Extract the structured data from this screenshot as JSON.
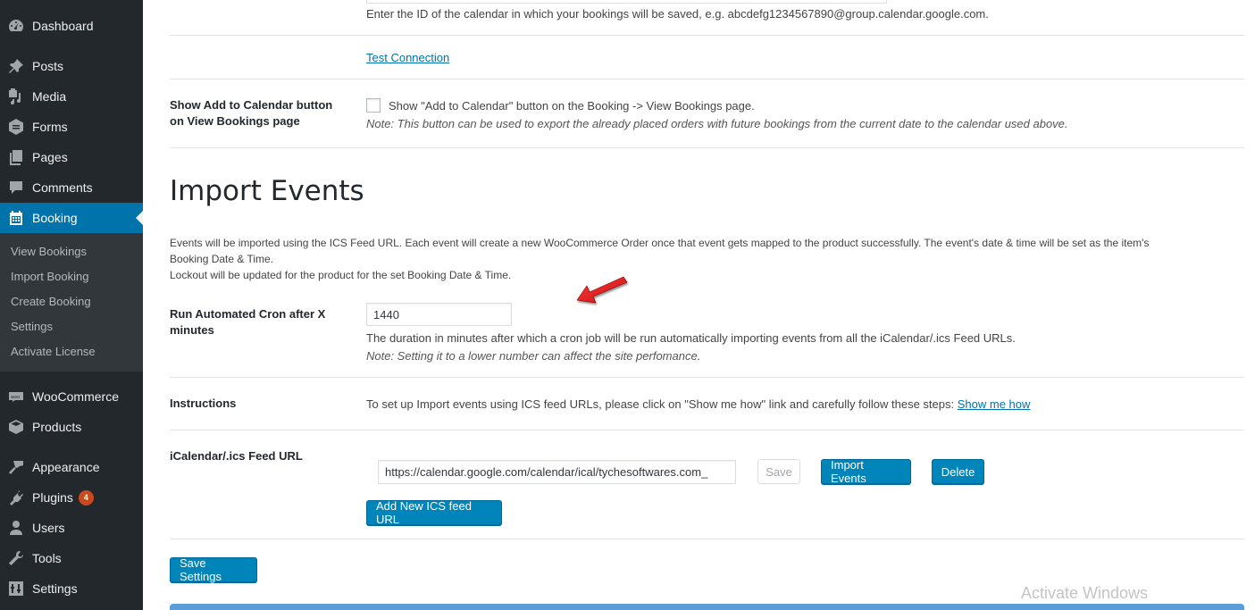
{
  "sidebar": {
    "items": [
      {
        "label": "Dashboard",
        "icon": "dashboard-icon"
      },
      {
        "label": "Posts",
        "icon": "pin-icon"
      },
      {
        "label": "Media",
        "icon": "media-icon"
      },
      {
        "label": "Forms",
        "icon": "forms-icon"
      },
      {
        "label": "Pages",
        "icon": "pages-icon"
      },
      {
        "label": "Comments",
        "icon": "comment-icon"
      },
      {
        "label": "Booking",
        "icon": "calendar-icon",
        "active": true
      },
      {
        "label": "WooCommerce",
        "icon": "woo-icon"
      },
      {
        "label": "Products",
        "icon": "box-icon"
      },
      {
        "label": "Appearance",
        "icon": "brush-icon"
      },
      {
        "label": "Plugins",
        "icon": "plug-icon",
        "badge": "4"
      },
      {
        "label": "Users",
        "icon": "user-icon"
      },
      {
        "label": "Tools",
        "icon": "wrench-icon"
      },
      {
        "label": "Settings",
        "icon": "sliders-icon"
      }
    ],
    "submenu": [
      "View Bookings",
      "Import Booking",
      "Create Booking",
      "Settings",
      "Activate License"
    ]
  },
  "calendar_section": {
    "calendar_id_help": "Enter the ID of the calendar in which your bookings will be saved, e.g. abcdefg1234567890@group.calendar.google.com.",
    "test_connection_link": "Test Connection",
    "add_to_calendar_label": "Show Add to Calendar button on View Bookings page",
    "add_to_calendar_checkbox_text": "Show \"Add to Calendar\" button on the Booking -> View Bookings page.",
    "add_to_calendar_checked": false,
    "add_to_calendar_note": "Note: This button can be used to export the already placed orders with future bookings from the current date to the calendar used above."
  },
  "import_events": {
    "title": "Import Events",
    "description_line1": "Events will be imported using the ICS Feed URL. Each event will create a new WooCommerce Order once that event gets mapped to the product successfully. The event's date & time will be set as the item's",
    "description_line2": "Booking Date & Time.",
    "description_line3": "Lockout will be updated for the product for the set Booking Date & Time.",
    "cron_label": "Run Automated Cron after X minutes",
    "cron_value": "1440",
    "cron_help": "The duration in minutes after which a cron job will be run automatically importing events from all the iCalendar/.ics Feed URLs.",
    "cron_note": "Note: Setting it to a lower number can affect the site perfomance.",
    "instructions_label": "Instructions",
    "instructions_text": "To set up Import events using ICS feed URLs, please click on \"Show me how\" link and carefully follow these steps:",
    "show_me_how_link": "Show me how",
    "feed_url_label": "iCalendar/.ics Feed URL",
    "feed_url_value": "https://calendar.google.com/calendar/ical/tychesoftwares.com_",
    "save_button": "Save",
    "import_events_button": "Import Events",
    "delete_button": "Delete",
    "add_feed_button": "Add New ICS feed URL",
    "save_settings_button": "Save Settings"
  },
  "overlay": {
    "watermark": "Activate Windows"
  },
  "colors": {
    "sidebar_bg": "#23282d",
    "submenu_bg": "#32373c",
    "accent": "#0073aa",
    "button_primary": "#0085ba",
    "badge": "#ca4a1f",
    "annotation_arrow": "#e01b1b"
  }
}
